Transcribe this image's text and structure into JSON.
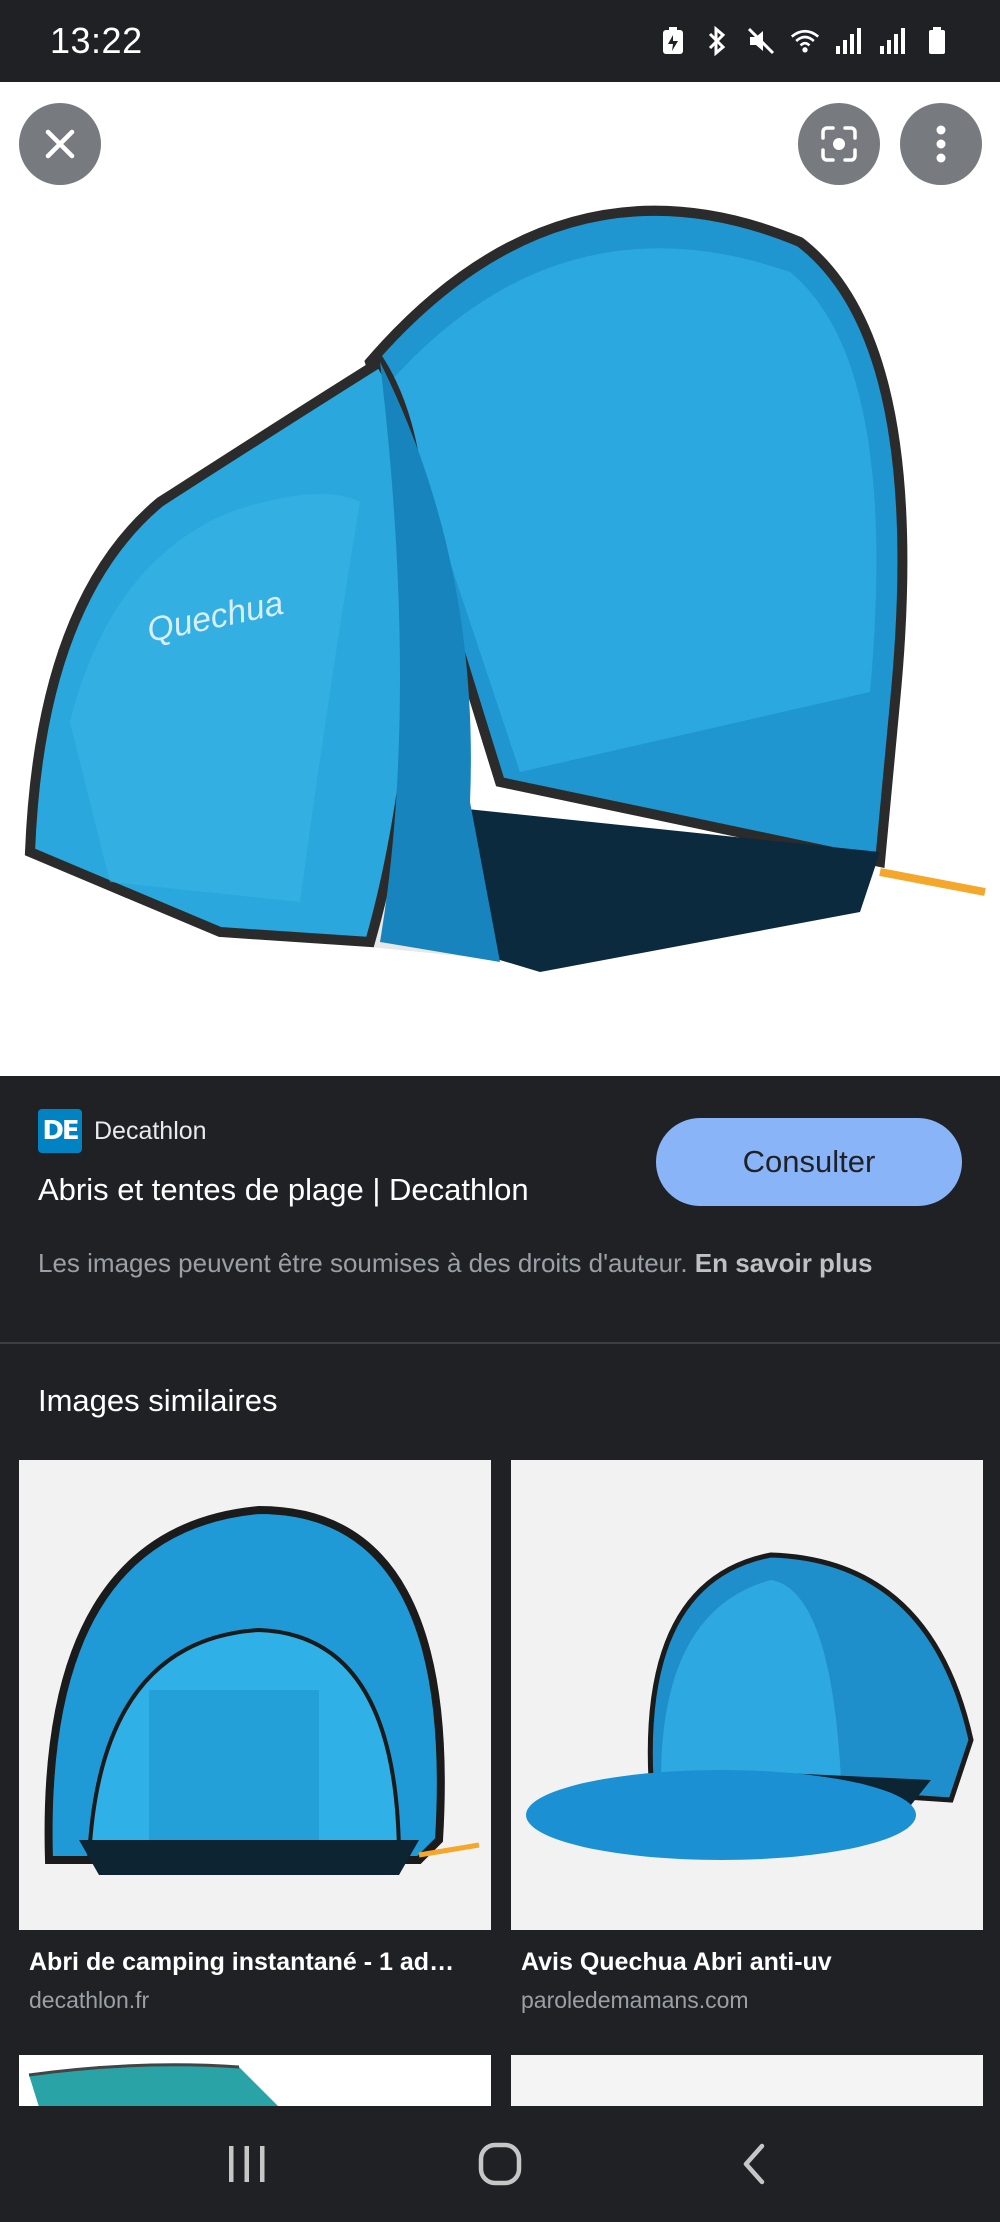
{
  "status_bar": {
    "time": "13:22",
    "icons": [
      "battery-saver-icon",
      "bluetooth-icon",
      "mute-icon",
      "wifi-icon",
      "signal-icon",
      "signal-icon",
      "battery-icon"
    ]
  },
  "hero": {
    "close_icon": "close-icon",
    "lens_icon": "lens-icon",
    "more_icon": "more-vert-icon",
    "tent_logo_text": "Quechua"
  },
  "source": {
    "logo_text": "DE",
    "name": "Decathlon",
    "title": "Abris et tentes de plage | Decathlon",
    "button_label": "Consulter"
  },
  "copyright": {
    "text": "Les images peuvent être soumises à des droits d'auteur. ",
    "learn_more": "En savoir plus"
  },
  "similar": {
    "heading": "Images similaires",
    "items": [
      {
        "title": "Abri de camping instantané - 1 ad…",
        "domain": "decathlon.fr"
      },
      {
        "title": "Avis Quechua Abri anti-uv",
        "domain": "paroledemamans.com"
      },
      {
        "title": "",
        "domain": ""
      },
      {
        "title": "",
        "domain": ""
      }
    ]
  },
  "nav": {
    "recents_icon": "recents-icon",
    "home_icon": "home-icon",
    "back_icon": "back-icon"
  },
  "colors": {
    "accent": "#8ab4f8",
    "background": "#202124",
    "tent_blue": "#2aa7dc",
    "decathlon_blue": "#0082c3"
  }
}
